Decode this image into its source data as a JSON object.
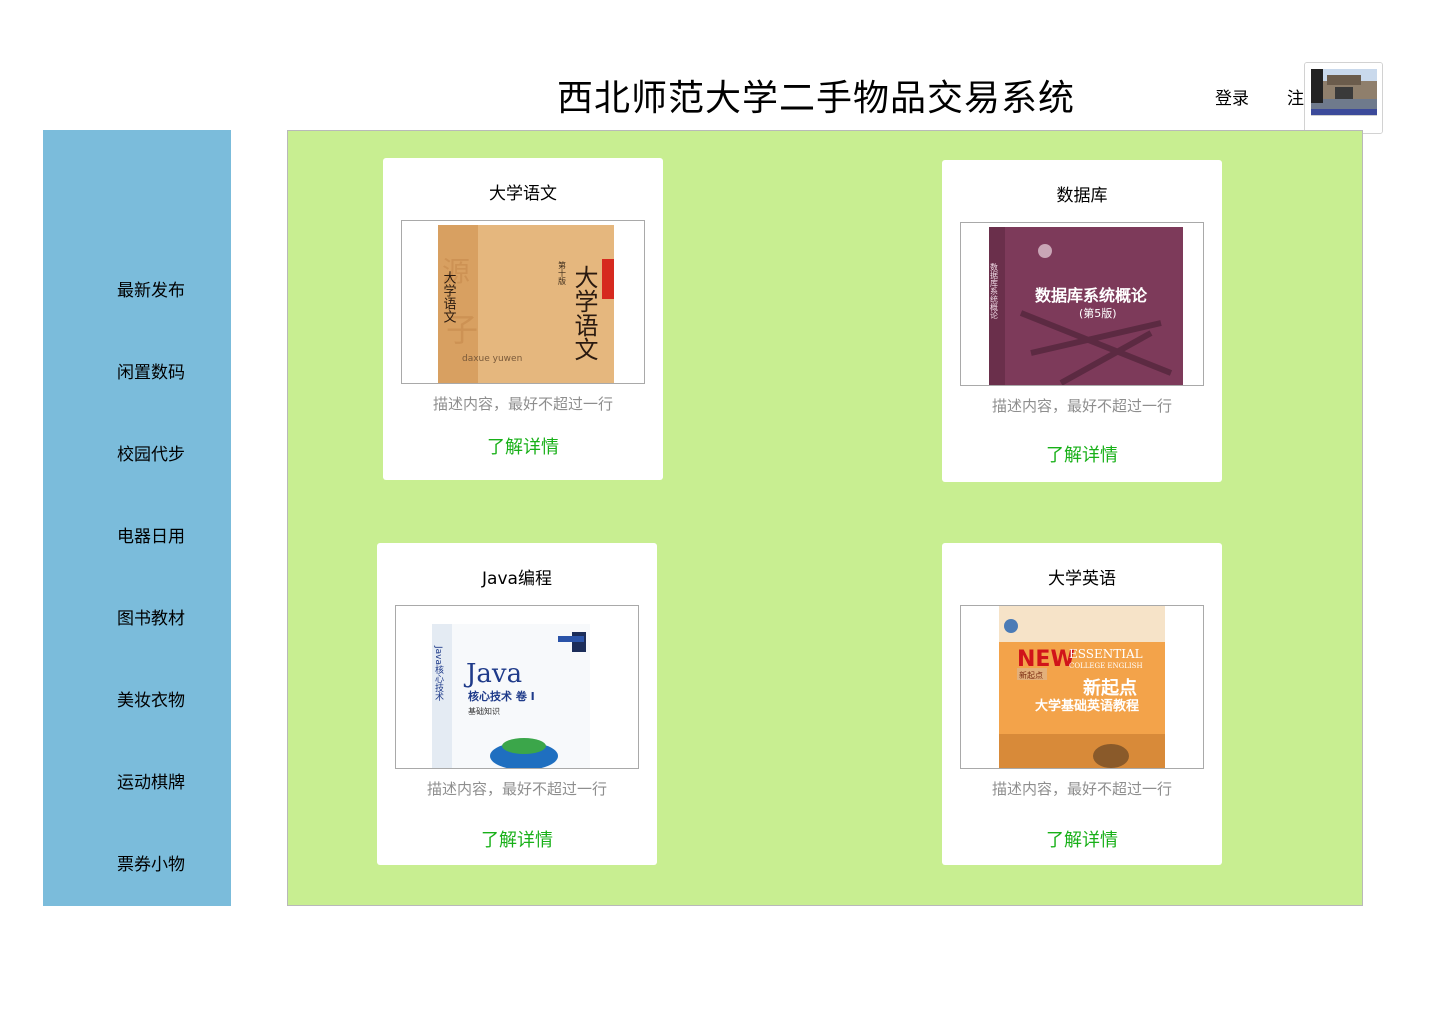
{
  "header": {
    "title": "西北师范大学二手物品交易系统",
    "login_label": "登录",
    "register_label": "注册"
  },
  "sidebar": {
    "items": [
      {
        "label": "最新发布"
      },
      {
        "label": "闲置数码"
      },
      {
        "label": "校园代步"
      },
      {
        "label": "电器日用"
      },
      {
        "label": "图书教材"
      },
      {
        "label": "美妆衣物"
      },
      {
        "label": "运动棋牌"
      },
      {
        "label": "票券小物"
      }
    ]
  },
  "products": [
    {
      "title": "大学语文",
      "description": "描述内容，最好不超过一行",
      "link_label": "了解详情",
      "cover": {
        "big_text": "大学语文",
        "edition": "第十版",
        "side": "大学语文",
        "pinyin": "daxue yuwen"
      }
    },
    {
      "title": "数据库",
      "description": "描述内容，最好不超过一行",
      "link_label": "了解详情",
      "cover": {
        "big_text": "数据库系统概论",
        "edition": "(第5版)",
        "side": "数据库系统概论"
      }
    },
    {
      "title": "Java编程",
      "description": "描述内容，最好不超过一行",
      "link_label": "了解详情",
      "cover": {
        "big_text": "Java",
        "subtitle": "核心技术 卷 I",
        "sub2": "基础知识",
        "side": "Java核心技术"
      }
    },
    {
      "title": "大学英语",
      "description": "描述内容，最好不超过一行",
      "link_label": "了解详情",
      "cover": {
        "big_text": "NEW",
        "sub_en": "ESSENTIAL",
        "sub_en2": "COLLEGE ENGLISH",
        "title_cn": "新起点",
        "subtitle_cn": "大学基础英语教程",
        "badge": "新起点"
      }
    }
  ],
  "colors": {
    "sidebar_bg": "#7bbcdb",
    "main_bg": "#c8ee91",
    "link_green": "#18b018",
    "desc_gray": "#8e8e8e"
  },
  "icons": {
    "avatar": "campus-gate-photo"
  }
}
